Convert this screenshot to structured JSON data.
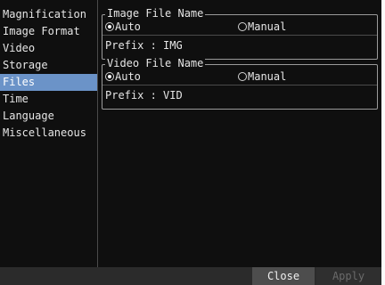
{
  "sidebar": {
    "items": [
      {
        "label": "Magnification",
        "selected": false
      },
      {
        "label": "Image Format",
        "selected": false
      },
      {
        "label": "Video",
        "selected": false
      },
      {
        "label": "Storage",
        "selected": false
      },
      {
        "label": "Files",
        "selected": true
      },
      {
        "label": "Time",
        "selected": false
      },
      {
        "label": "Language",
        "selected": false
      },
      {
        "label": "Miscellaneous",
        "selected": false
      }
    ]
  },
  "image_file_name": {
    "title": "Image File Name",
    "options": {
      "auto": "Auto",
      "manual": "Manual"
    },
    "selected": "auto",
    "prefix_label": "Prefix",
    "prefix_value": "IMG"
  },
  "video_file_name": {
    "title": "Video File Name",
    "options": {
      "auto": "Auto",
      "manual": "Manual"
    },
    "selected": "auto",
    "prefix_label": "Prefix",
    "prefix_value": "VID"
  },
  "buttons": {
    "close": "Close",
    "apply": "Apply"
  },
  "colors": {
    "background": "#0f0f0f",
    "selected_item": "#6b93c8",
    "bottom_bar": "#2b2b2b",
    "button_active": "#4d4d4d",
    "button_disabled_text": "#6a6a6a"
  }
}
